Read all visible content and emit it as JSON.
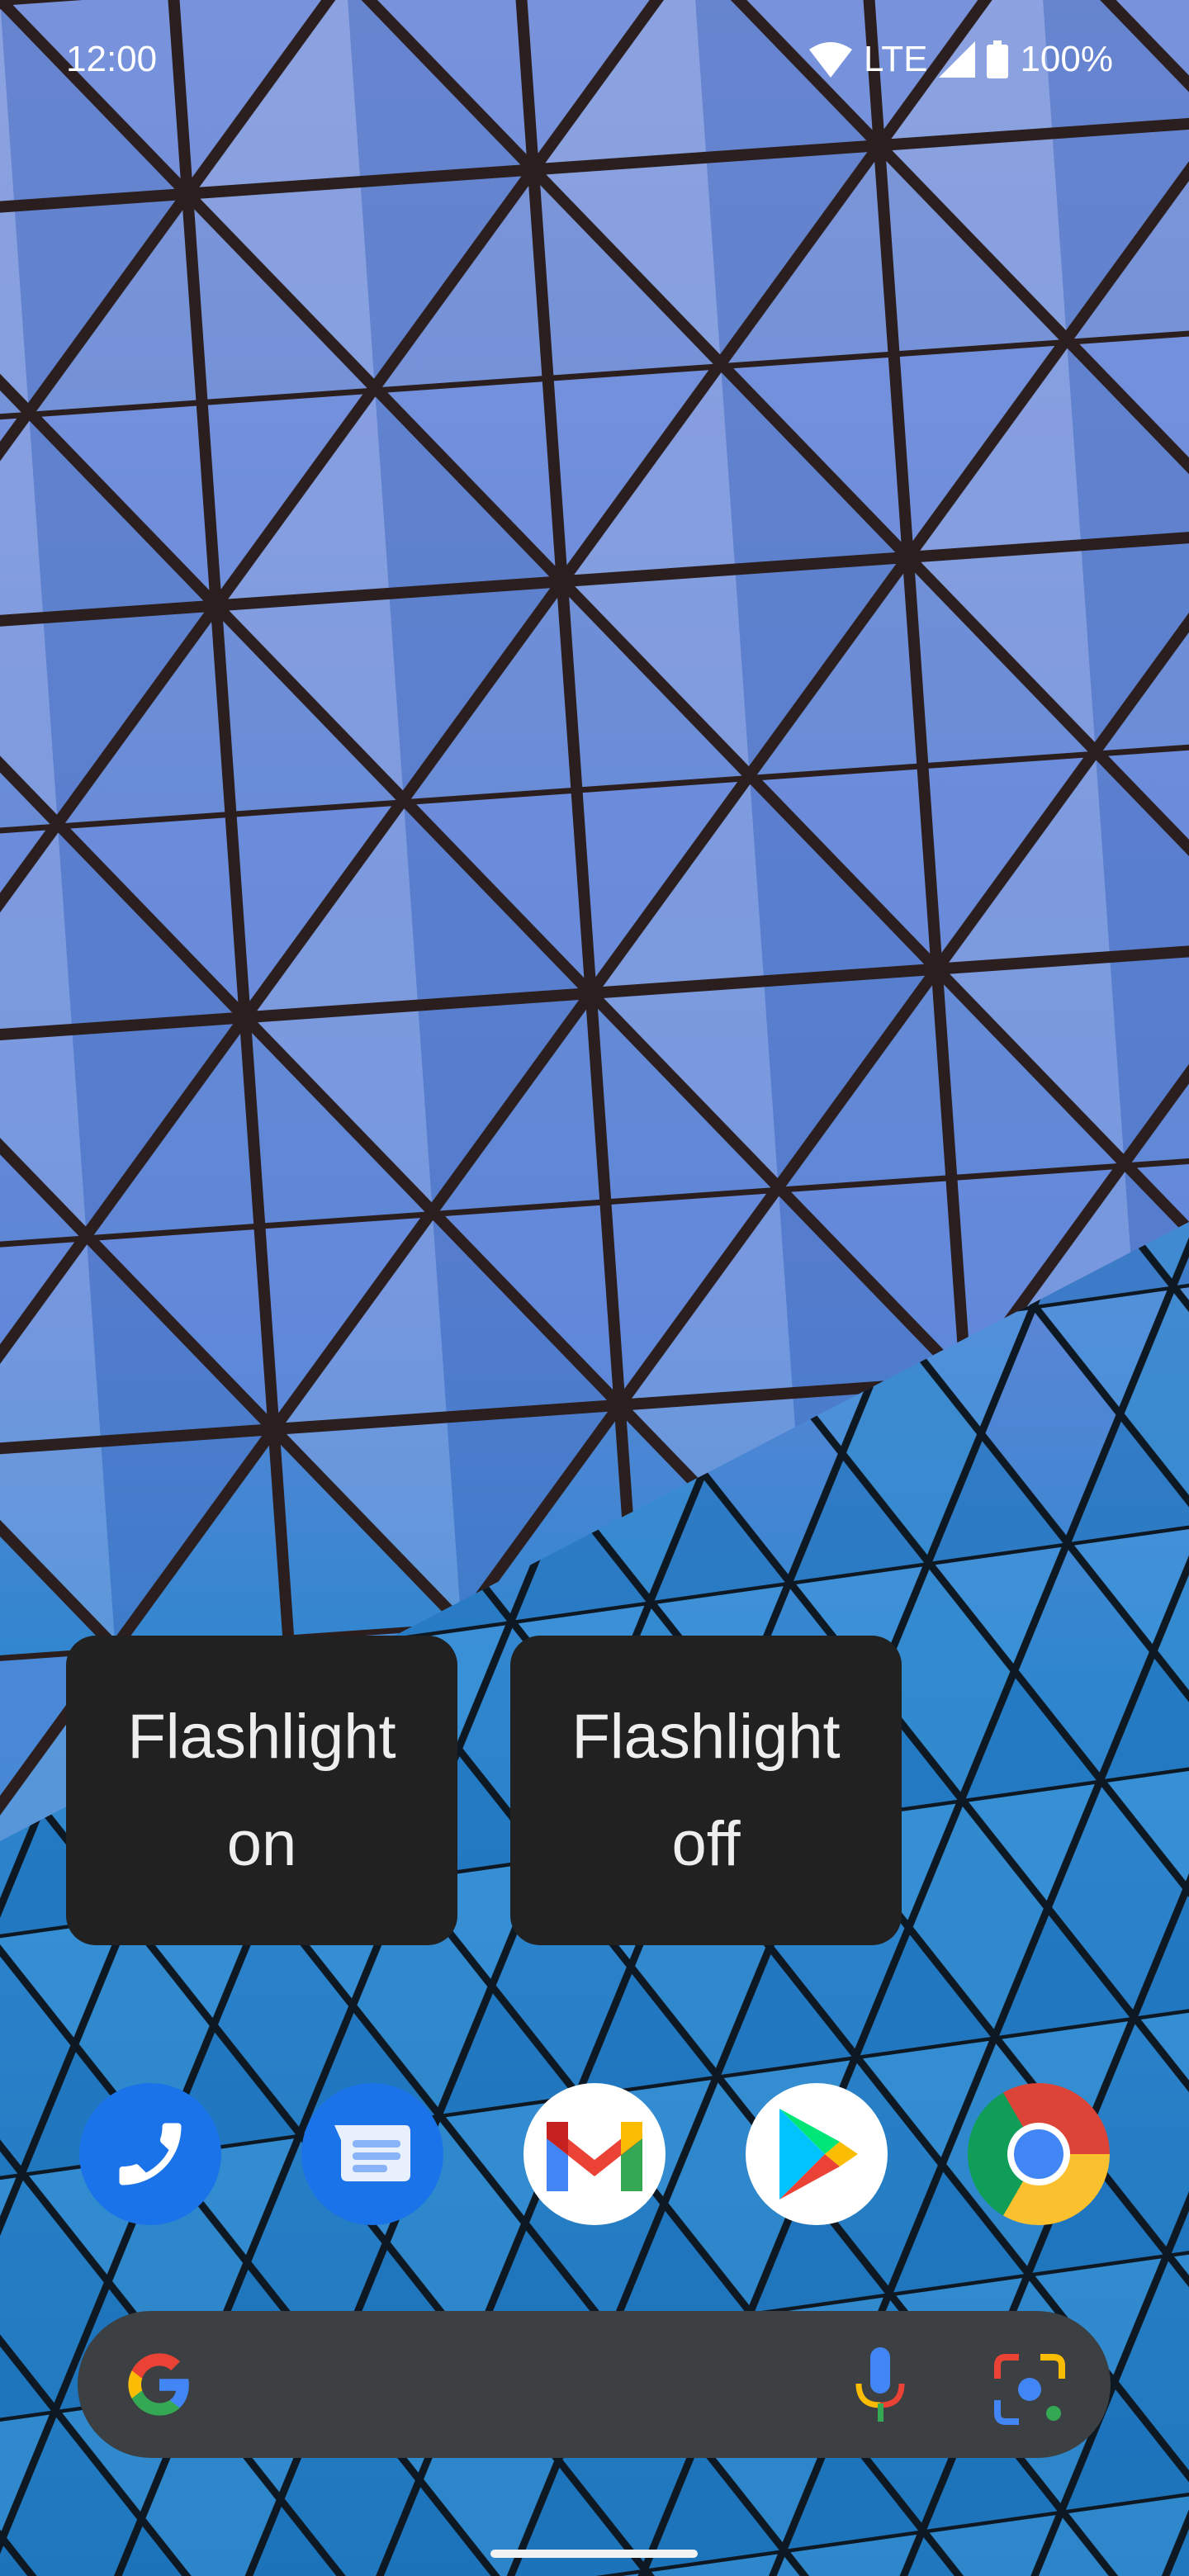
{
  "status_bar": {
    "time": "12:00",
    "network": "LTE",
    "battery": "100%",
    "icons": [
      "wifi-icon",
      "signal-icon",
      "battery-icon"
    ]
  },
  "widgets": [
    {
      "line1": "Flashlight",
      "line2": "on"
    },
    {
      "line1": "Flashlight",
      "line2": "off"
    }
  ],
  "dock": [
    "phone-icon",
    "messages-icon",
    "gmail-icon",
    "play-store-icon",
    "chrome-icon"
  ],
  "search_bar": {
    "icons": [
      "google-g-icon",
      "microphone-icon",
      "google-lens-icon"
    ]
  },
  "colors": {
    "widget_bg": "#212121",
    "search_bg": "#3c4043",
    "google_blue": "#4285f4",
    "google_red": "#ea4335",
    "google_yellow": "#fbbc04",
    "google_green": "#34a853"
  }
}
